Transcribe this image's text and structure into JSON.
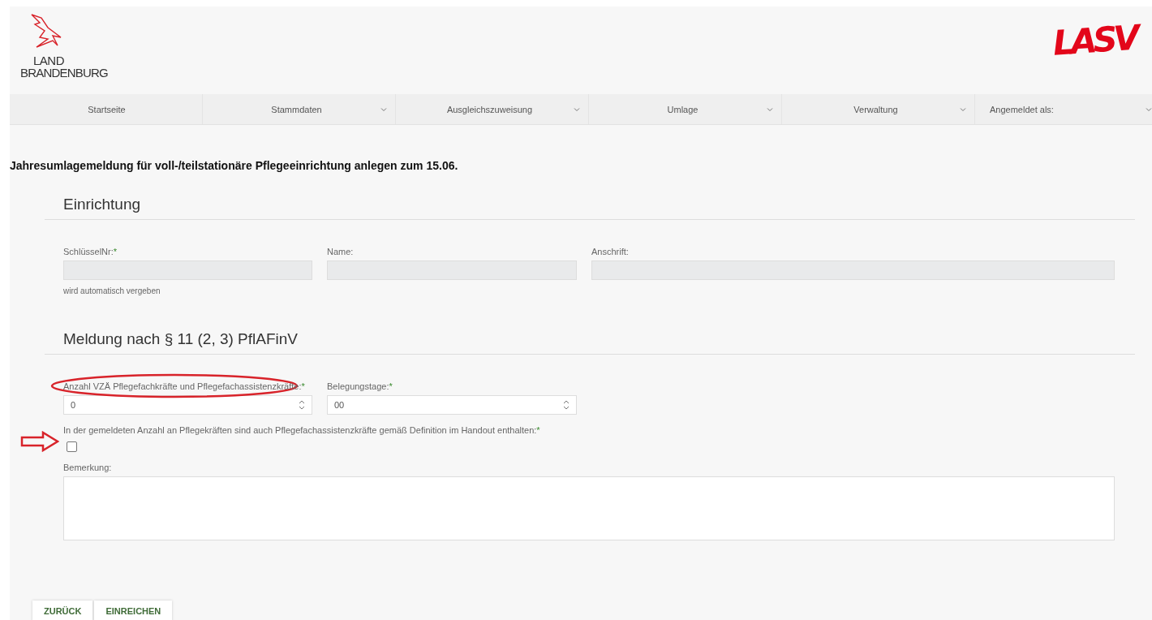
{
  "header": {
    "logo_left": {
      "line1": "LAND",
      "line2": "BRANDENBURG"
    },
    "logo_right": "LASV"
  },
  "nav": [
    {
      "label": "Startseite",
      "dropdown": false
    },
    {
      "label": "Stammdaten",
      "dropdown": true
    },
    {
      "label": "Ausgleichszuweisung",
      "dropdown": true
    },
    {
      "label": "Umlage",
      "dropdown": true
    },
    {
      "label": "Verwaltung",
      "dropdown": true
    },
    {
      "label": "Angemeldet als:",
      "dropdown": true
    }
  ],
  "page_title": "Jahresumlagemeldung für voll-/teilstationäre Pflegeeinrichtung anlegen zum 15.06.",
  "sections": [
    {
      "heading": "Einrichtung",
      "fields": [
        {
          "kind": "text",
          "label": "SchlüsselNr:",
          "required_mark": "*",
          "disabled": true,
          "hint": "wird automatisch vergeben",
          "highlighted": false
        },
        {
          "kind": "text",
          "label": "Name:",
          "disabled": true,
          "highlighted": false
        },
        {
          "kind": "text",
          "label": "Anschrift:",
          "disabled": true,
          "highlighted": false
        }
      ]
    },
    {
      "heading": "Meldung nach § 11 (2, 3) PflAFinV",
      "fields": [
        {
          "kind": "number",
          "label": "Anzahl VZÄ Pflegefachkräfte und Pflegefachassistenzkräfte:",
          "required_mark": "*",
          "value": "0",
          "disabled": false,
          "highlighted": true
        },
        {
          "kind": "number",
          "label": "Belegungstage:",
          "required_mark": "*",
          "value": "00",
          "disabled": false,
          "highlighted": false
        },
        {
          "kind": "checkbox",
          "label": "In der gemeldeten Anzahl an Pflegekräften sind auch Pflegefachassistenzkräfte gemäß Definition im Handout enthalten:",
          "required_mark": "*",
          "checked": false,
          "arrow": true
        },
        {
          "kind": "textarea",
          "label": "Bemerkung:",
          "disabled": false,
          "highlighted": false
        }
      ]
    }
  ],
  "buttons": [
    "ZURÜCK",
    "EINREICHEN"
  ]
}
